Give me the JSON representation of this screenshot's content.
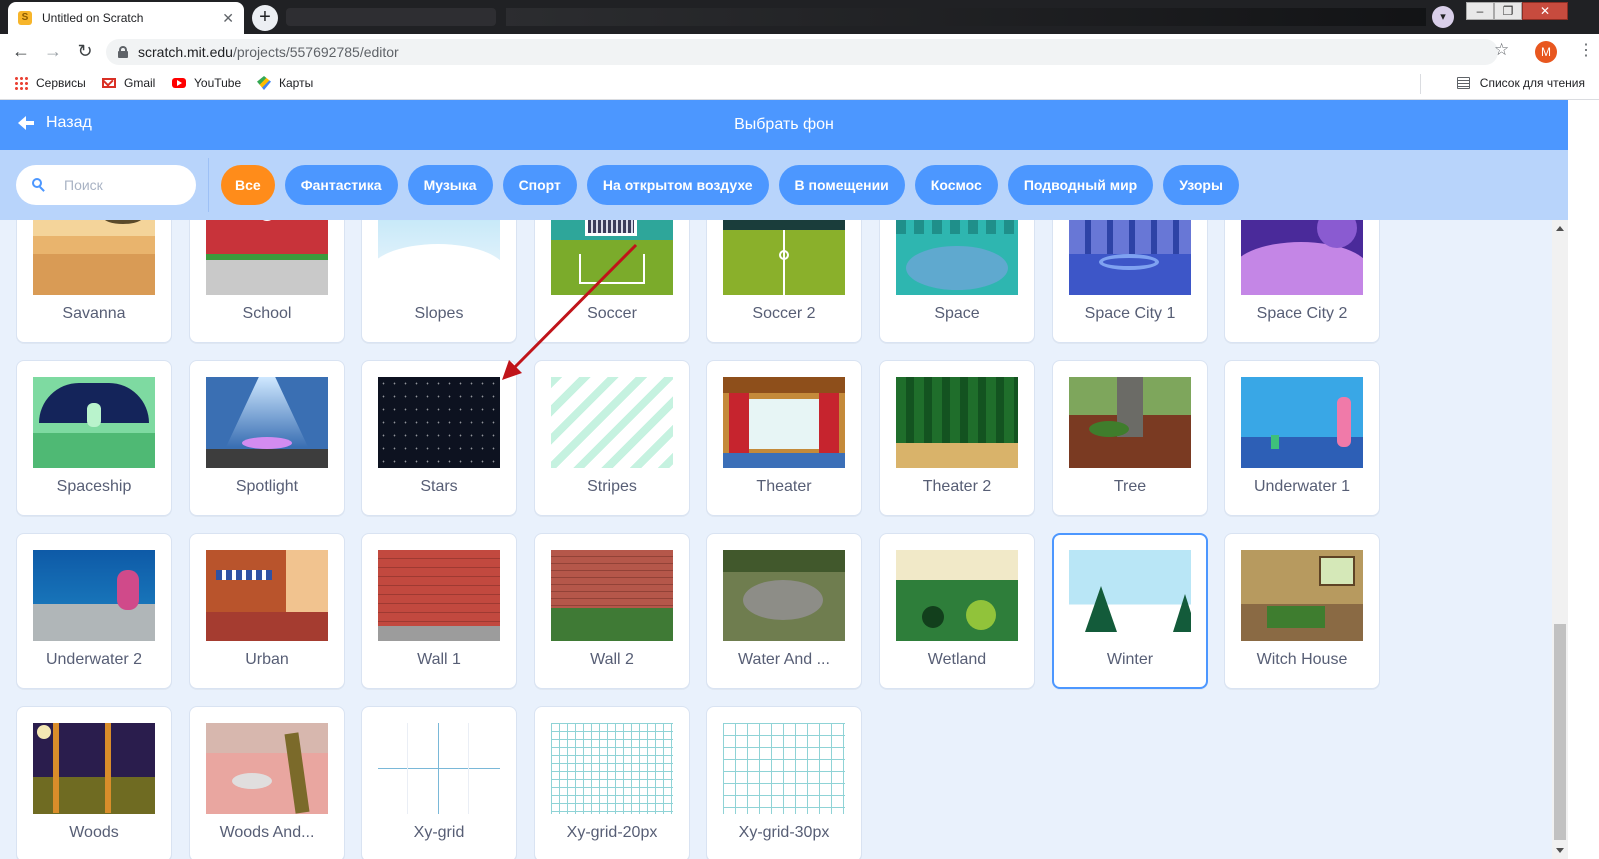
{
  "browser": {
    "tab_title": "Untitled on Scratch",
    "tab_favicon": "scratch-cat-icon",
    "url_domain": "scratch.mit.edu",
    "url_path": "/projects/557692785/editor",
    "avatar_letter": "M",
    "bookmarks": [
      {
        "label": "Сервисы",
        "icon": "apps-grid-icon"
      },
      {
        "label": "Gmail",
        "icon": "gmail-icon"
      },
      {
        "label": "YouTube",
        "icon": "youtube-icon"
      },
      {
        "label": "Карты",
        "icon": "maps-icon"
      }
    ],
    "reading_list": "Список для чтения"
  },
  "header": {
    "back_label": "Назад",
    "title": "Выбрать фон"
  },
  "search": {
    "placeholder": "Поиск"
  },
  "categories": [
    {
      "label": "Все",
      "active": true
    },
    {
      "label": "Фантастика"
    },
    {
      "label": "Музыка"
    },
    {
      "label": "Спорт"
    },
    {
      "label": "На открытом воздухе"
    },
    {
      "label": "В помещении"
    },
    {
      "label": "Космос"
    },
    {
      "label": "Подводный мир"
    },
    {
      "label": "Узоры"
    }
  ],
  "backdrops": [
    {
      "name": "Savanna"
    },
    {
      "name": "School"
    },
    {
      "name": "Slopes"
    },
    {
      "name": "Soccer"
    },
    {
      "name": "Soccer 2"
    },
    {
      "name": "Space"
    },
    {
      "name": "Space City 1"
    },
    {
      "name": "Space City 2"
    },
    {
      "name": "Spaceship"
    },
    {
      "name": "Spotlight"
    },
    {
      "name": "Stars"
    },
    {
      "name": "Stripes"
    },
    {
      "name": "Theater"
    },
    {
      "name": "Theater 2"
    },
    {
      "name": "Tree"
    },
    {
      "name": "Underwater 1"
    },
    {
      "name": "Underwater 2"
    },
    {
      "name": "Urban"
    },
    {
      "name": "Wall 1"
    },
    {
      "name": "Wall 2"
    },
    {
      "name": "Water And ..."
    },
    {
      "name": "Wetland"
    },
    {
      "name": "Winter",
      "selected": true
    },
    {
      "name": "Witch House"
    },
    {
      "name": "Woods"
    },
    {
      "name": "Woods And..."
    },
    {
      "name": "Xy-grid"
    },
    {
      "name": "Xy-grid-20px"
    },
    {
      "name": "Xy-grid-30px"
    }
  ],
  "colors": {
    "header_blue": "#4c97ff",
    "filter_bar": "#b8d4fb",
    "active_chip": "#ff8c1a",
    "annotation_arrow": "#c0141a"
  }
}
